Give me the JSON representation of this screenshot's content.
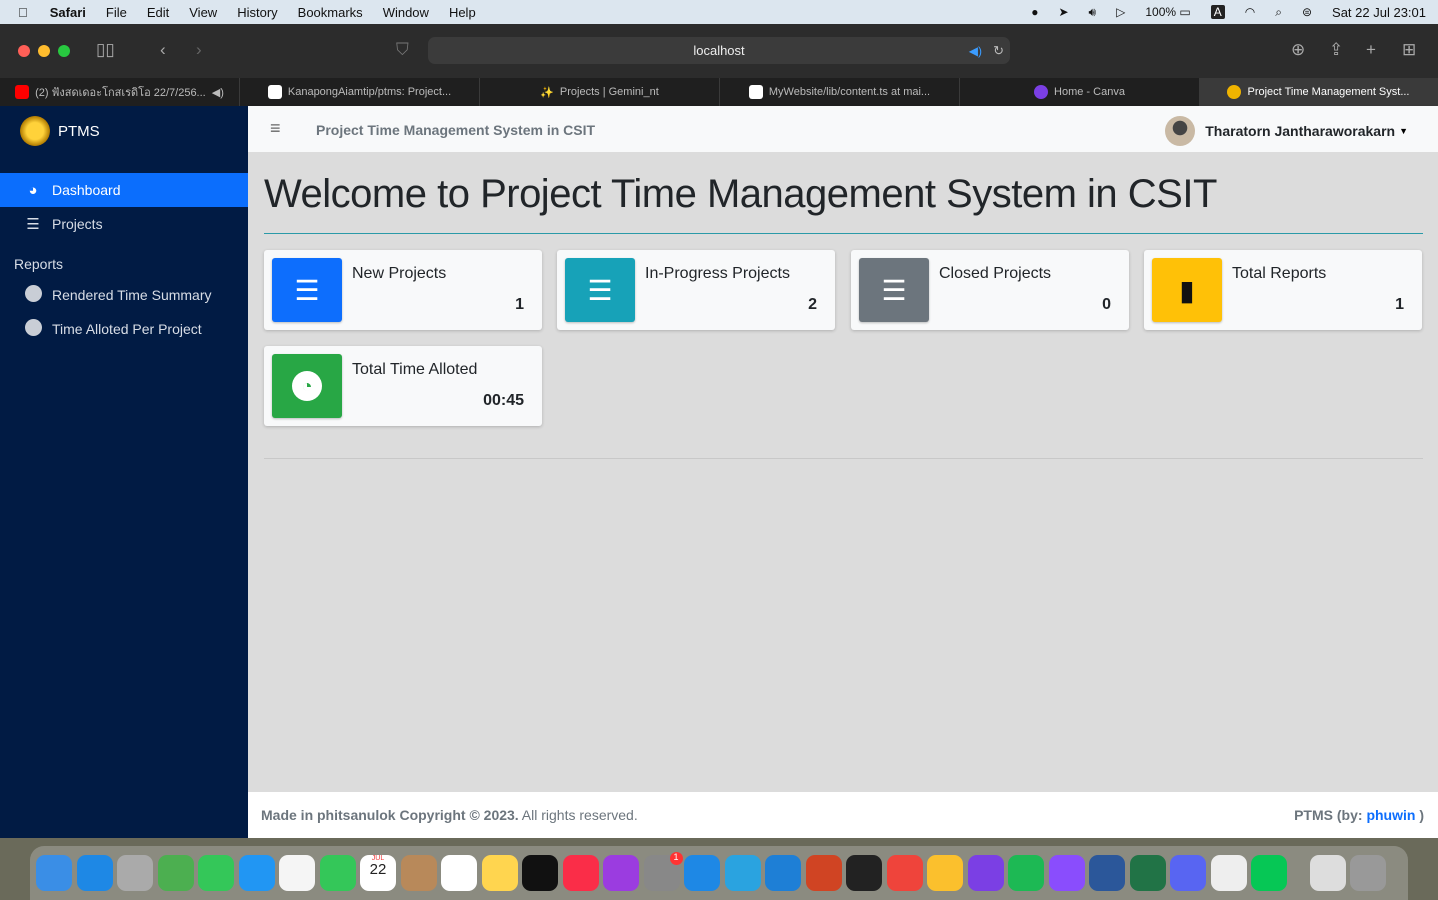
{
  "menubar": {
    "app": "Safari",
    "items": [
      "File",
      "Edit",
      "View",
      "History",
      "Bookmarks",
      "Window",
      "Help"
    ],
    "battery": "100%",
    "datetime": "Sat 22 Jul  23:01",
    "input_source": "A"
  },
  "browser": {
    "url": "localhost",
    "tabs": [
      {
        "title": "(2) ฟังสดเดอะโกสเรดิโอ 22/7/256...",
        "icon": "youtube-icon",
        "color": "#ff0000"
      },
      {
        "title": "KanapongAiamtip/ptms: Project...",
        "icon": "github-icon",
        "color": "#ffffff"
      },
      {
        "title": "Projects | Gemini_nt",
        "icon": "magic-wand-icon",
        "color": "#f0c040"
      },
      {
        "title": "MyWebsite/lib/content.ts at mai...",
        "icon": "github-icon",
        "color": "#ffffff"
      },
      {
        "title": "Home - Canva",
        "icon": "canva-icon",
        "color": "#7b3fe4"
      },
      {
        "title": "Project Time Management Syst...",
        "icon": "ptms-logo-icon",
        "color": "#f0b400",
        "active": true
      }
    ]
  },
  "sidebar": {
    "brand": "PTMS",
    "items": [
      {
        "label": "Dashboard",
        "icon": "dashboard-icon",
        "active": true
      },
      {
        "label": "Projects",
        "icon": "list-check-icon"
      }
    ],
    "section": "Reports",
    "reports": [
      {
        "label": "Rendered Time Summary"
      },
      {
        "label": "Time Alloted Per Project"
      }
    ]
  },
  "header": {
    "title": "Project Time Management System in CSIT",
    "user": "Tharatorn Jantharaworakarn"
  },
  "main": {
    "heading": "Welcome to Project Time Management System in CSIT",
    "cards": [
      {
        "label": "New Projects",
        "value": "1",
        "color": "#0d6efd",
        "icon": "list-check-icon"
      },
      {
        "label": "In-Progress Projects",
        "value": "2",
        "color": "#17a2b8",
        "icon": "list-check-icon"
      },
      {
        "label": "Closed Projects",
        "value": "0",
        "color": "#6c757d",
        "icon": "list-check-icon"
      },
      {
        "label": "Total Reports",
        "value": "1",
        "color": "#ffc107",
        "icon": "file-icon"
      },
      {
        "label": "Total Time Alloted",
        "value": "00:45",
        "color": "#28a745",
        "icon": "clock-icon"
      }
    ]
  },
  "footer": {
    "left_bold": "Made in phitsanulok Copyright © 2023.",
    "left_rest": " All rights reserved.",
    "right_prefix": "PTMS (by: ",
    "right_link": "phuwin",
    "right_suffix": " )"
  },
  "dock": {
    "calendar_month": "JUL",
    "calendar_day": "22",
    "badge": "1"
  }
}
